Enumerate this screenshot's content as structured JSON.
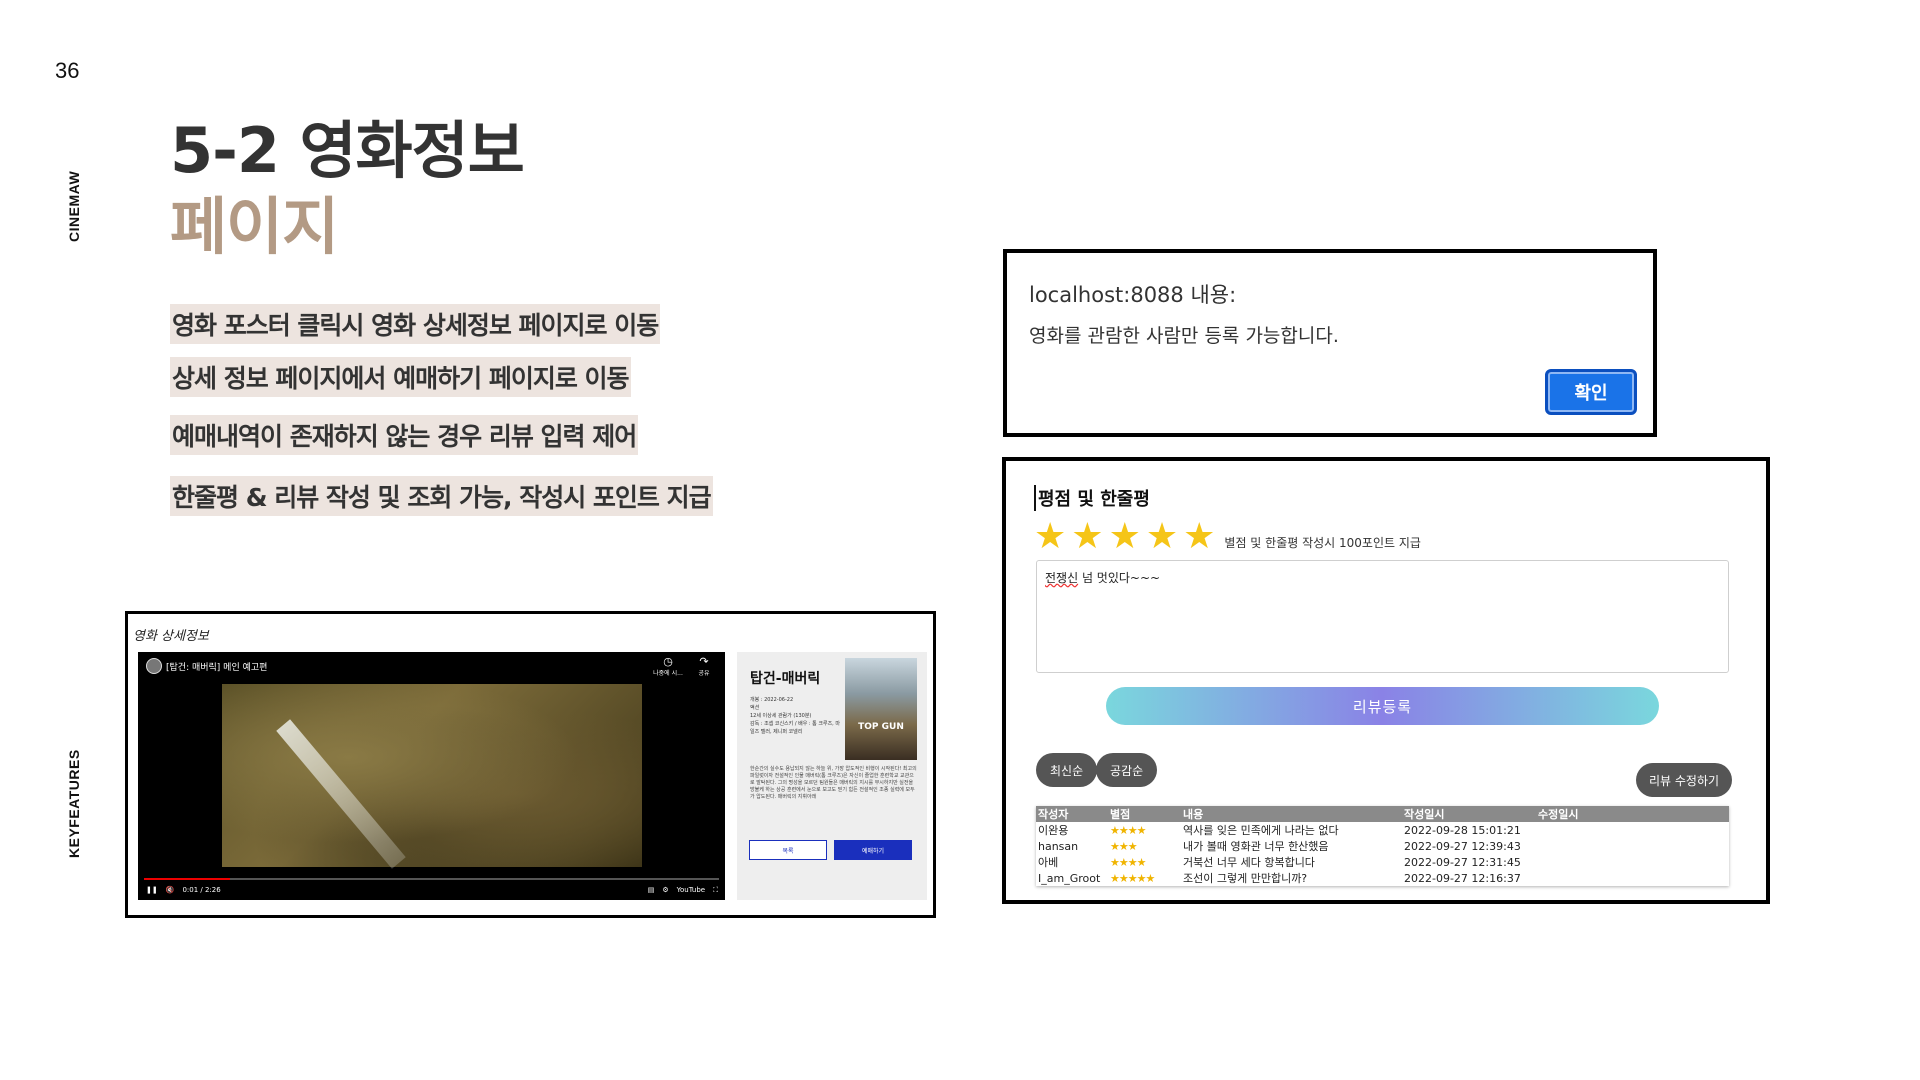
{
  "page_number": "36",
  "side_labels": {
    "brand": "CINEMAW",
    "section": "KEYFEATURES"
  },
  "title": {
    "main": "5-2 영화정보",
    "sub": "페이지"
  },
  "features": [
    "영화 포스터 클릭시 영화 상세정보 페이지로 이동",
    "상세 정보 페이지에서 예매하기 페이지로 이동",
    "예매내역이 존재하지 않는 경우 리뷰 입력 제어",
    "한줄평 & 리뷰 작성 및 조회 가능, 작성시 포인트 지급"
  ],
  "alert": {
    "origin": "localhost:8088 내용:",
    "message": "영화를 관람한 사람만 등록 가능합니다.",
    "ok_label": "확인",
    "accent_color": "#1a73e8"
  },
  "review": {
    "title": "평점 및 한줄평",
    "star_glyph": "★",
    "star_count": 5,
    "star_color": "#f5c518",
    "stars_note": "별점 및 한줄평 작성시 100포인트 지급",
    "textarea_typo": "전쟁신",
    "textarea_rest": " 넘 멋있다~~~",
    "submit_label": "리뷰등록",
    "sort_latest": "최신순",
    "sort_likes": "공감순",
    "edit_label": "리뷰 수정하기",
    "table": {
      "headers": [
        "작성자",
        "별점",
        "내용",
        "작성일시",
        "수정일시"
      ],
      "rows": [
        {
          "author": "이완용",
          "rating": "★★★★",
          "content": "역사를 잊은 민족에게 나라는 없다",
          "created": "2022-09-28 15:01:21",
          "modified": ""
        },
        {
          "author": "hansan",
          "rating": "★★★",
          "content": "내가 볼때 영화관 너무 한산했음",
          "created": "2022-09-27 12:39:43",
          "modified": ""
        },
        {
          "author": "아베",
          "rating": "★★★★",
          "content": "거북선 너무 세다 항복합니다",
          "created": "2022-09-27 12:31:45",
          "modified": ""
        },
        {
          "author": "I_am_Groot",
          "rating": "★★★★★",
          "content": "조선이 그렇게 만만합니까?",
          "created": "2022-09-27 12:16:37",
          "modified": ""
        }
      ]
    }
  },
  "detail": {
    "label": "영화 상세정보",
    "video": {
      "title": "[탑건: 매버릭] 메인 예고편",
      "watch_later_icon": "clock-icon",
      "watch_later_glyph": "◷",
      "watch_later_label": "나중에 시...",
      "share_icon": "share-icon",
      "share_glyph": "↷",
      "share_label": "공유",
      "pause_glyph": "❚❚",
      "volume_glyph": "🔇",
      "time": "0:01 / 2:26",
      "progress": 0.15,
      "subtitles_glyph": "▤",
      "settings_glyph": "⚙",
      "youtube_label": "YouTube",
      "fullscreen_glyph": "⛶"
    },
    "movie": {
      "title": "탑건-매버릭",
      "poster_text": "TOP GUN",
      "meta_lines": [
        "개봉 : 2022-06-22",
        "액션",
        "12세 이상세 관람가 (130분)",
        "감독 : 조셉 코신스키 / 배우 : 톰 크루즈, 마일즈 텔러, 제니퍼 코넬리"
      ],
      "synopsis": "한순간의 실수도 용납되지 않는 하늘 위, 가장 압도적인 비행이 시작된다! 최고의 파일럿이자 전설적인 인물 매버릭(톰 크루즈)은 자신이 졸업한 훈련학교 교관으로 발탁된다. 그의 명성을 모르던 팀원들은 매버릭의 지시를 무시하지만 실전을 방불케 하는 상공 훈련에서 눈으로 보고도 믿기 힘든 전설적인 조종 실력에 모두가 압도된다. 매버릭의 지휘아래",
      "list_label": "목록",
      "book_label": "예매하기"
    }
  }
}
